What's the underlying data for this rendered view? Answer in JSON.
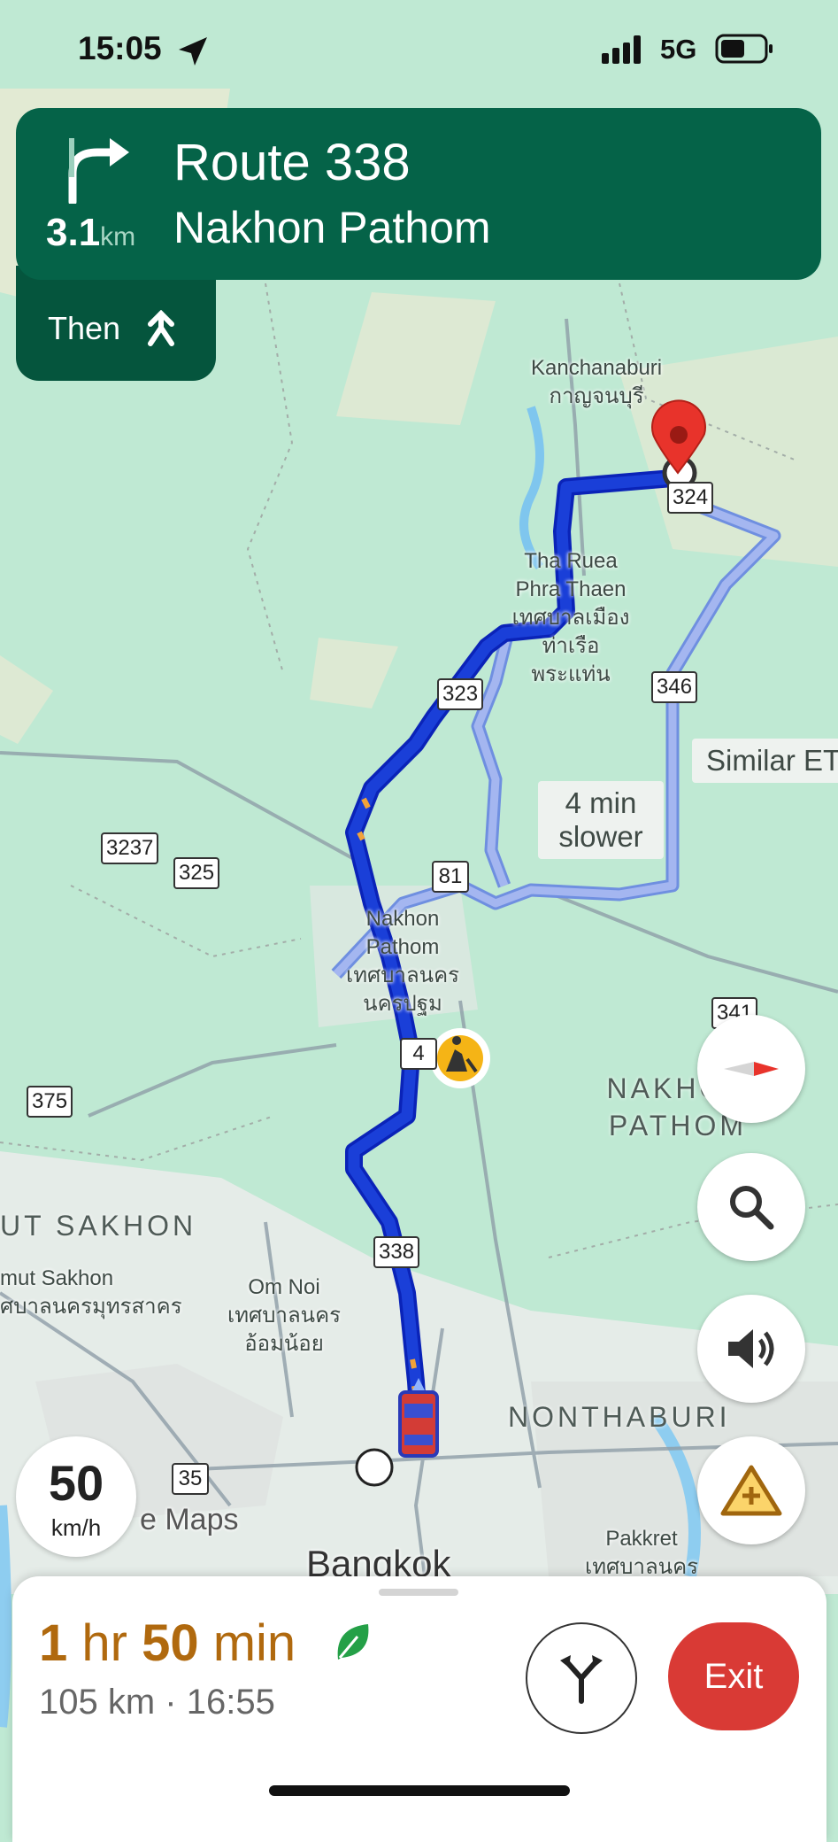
{
  "status_bar": {
    "time": "15:05",
    "network": "5G"
  },
  "nav": {
    "street": "Route 338",
    "city": "Nakhon Pathom",
    "distance_value": "3.1",
    "distance_unit": "km",
    "then_label": "Then",
    "maneuver_icon": "turn-right-icon",
    "then_icon": "merge-icon"
  },
  "map": {
    "places": [
      {
        "name": "Kanchanaburi",
        "thai": "กาญจนบุรี"
      },
      {
        "name": "Tha Ruea Phra Thaen",
        "thai": "เทศบาลเมืองท่าเรือพระแท่น"
      },
      {
        "name": "Nakhon Pathom",
        "thai": "เทศบาลนครนครปฐม"
      },
      {
        "name": "Om Noi",
        "thai": "เทศบาลนครอ้อมน้อย"
      },
      {
        "name": "mut Sakhon",
        "thai": "ศบาลนครมุทรสาคร"
      },
      {
        "name": "Pakkret",
        "thai": "เทศบาลนคร"
      }
    ],
    "regions": [
      "NAKHON PATHOM",
      "UT SAKHON",
      "NONTHABURI"
    ],
    "city_big": "Bangkok",
    "watermark": "e Maps",
    "route_shields": [
      "324",
      "346",
      "323",
      "81",
      "3237",
      "325",
      "375",
      "4",
      "338",
      "35",
      "341"
    ],
    "alt_route_callout": "4 min slower",
    "similar_eta_callout": "Similar ET",
    "colors": {
      "route": "#1a3fd8",
      "alt_route": "#a4b6f0",
      "nav_green": "#056348"
    }
  },
  "speed": {
    "value": "50",
    "unit": "km/h"
  },
  "trip": {
    "eta_hr": "1",
    "eta_hr_label": "hr",
    "eta_min": "50",
    "eta_min_label": "min",
    "details": "105 km · 16:55",
    "exit_label": "Exit"
  }
}
